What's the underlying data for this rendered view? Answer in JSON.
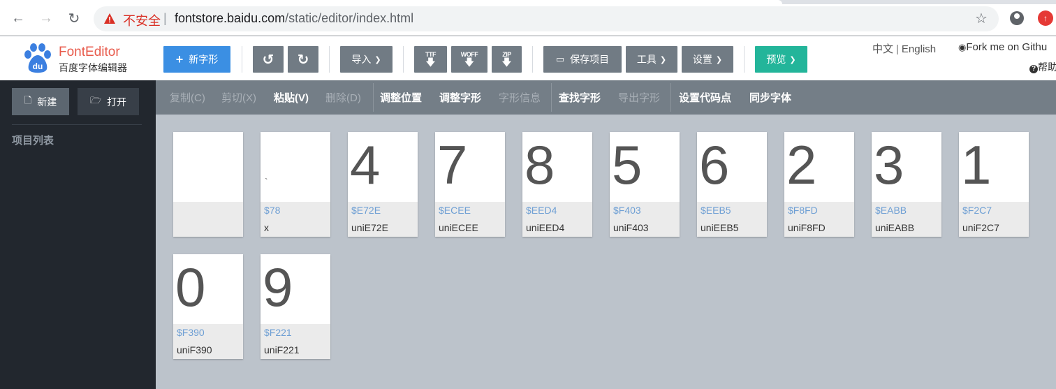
{
  "browser": {
    "insecure_label": "不安全",
    "url_host": "fontstore.baidu.com",
    "url_path": "/static/editor/index.html"
  },
  "header": {
    "logo_title": "FontEditor",
    "logo_subtitle": "百度字体编辑器",
    "logo_mark": "du",
    "new_glyph": "新字形",
    "import": "导入",
    "ttf": "TTF",
    "woff": "WOFF",
    "zip": "ZIP",
    "save_project": "保存项目",
    "tools": "工具",
    "settings": "设置",
    "preview": "预览",
    "lang_zh": "中文",
    "lang_sep": "|",
    "lang_en": "English",
    "fork": "Fork me on Githu",
    "help": "帮助"
  },
  "sidebar": {
    "new": "新建",
    "open": "打开",
    "project_list": "项目列表"
  },
  "commands": {
    "copy": "复制(C)",
    "cut": "剪切(X)",
    "paste": "粘贴(V)",
    "delete": "删除(D)",
    "adjust_pos": "调整位置",
    "adjust_glyph": "调整字形",
    "glyph_info": "字形信息",
    "find_glyph": "查找字形",
    "export_glyph": "导出字形",
    "set_codepoint": "设置代码点",
    "sync_font": "同步字体"
  },
  "glyphs": [
    {
      "char": "",
      "code": "",
      "name": ""
    },
    {
      "char": "`",
      "code": "$78",
      "name": "x"
    },
    {
      "char": "4",
      "code": "$E72E",
      "name": "uniE72E"
    },
    {
      "char": "7",
      "code": "$ECEE",
      "name": "uniECEE"
    },
    {
      "char": "8",
      "code": "$EED4",
      "name": "uniEED4"
    },
    {
      "char": "5",
      "code": "$F403",
      "name": "uniF403"
    },
    {
      "char": "6",
      "code": "$EEB5",
      "name": "uniEEB5"
    },
    {
      "char": "2",
      "code": "$F8FD",
      "name": "uniF8FD"
    },
    {
      "char": "3",
      "code": "$EABB",
      "name": "uniEABB"
    },
    {
      "char": "1",
      "code": "$F2C7",
      "name": "uniF2C7"
    },
    {
      "char": "0",
      "code": "$F390",
      "name": "uniF390"
    },
    {
      "char": "9",
      "code": "$F221",
      "name": "uniF221"
    }
  ],
  "colors": {
    "primary_blue": "#3b8fe3",
    "preview_green": "#23b59a",
    "toolbar_gray": "#717b84",
    "sidebar_bg": "#22272e",
    "code_blue": "#6e9fd4"
  }
}
